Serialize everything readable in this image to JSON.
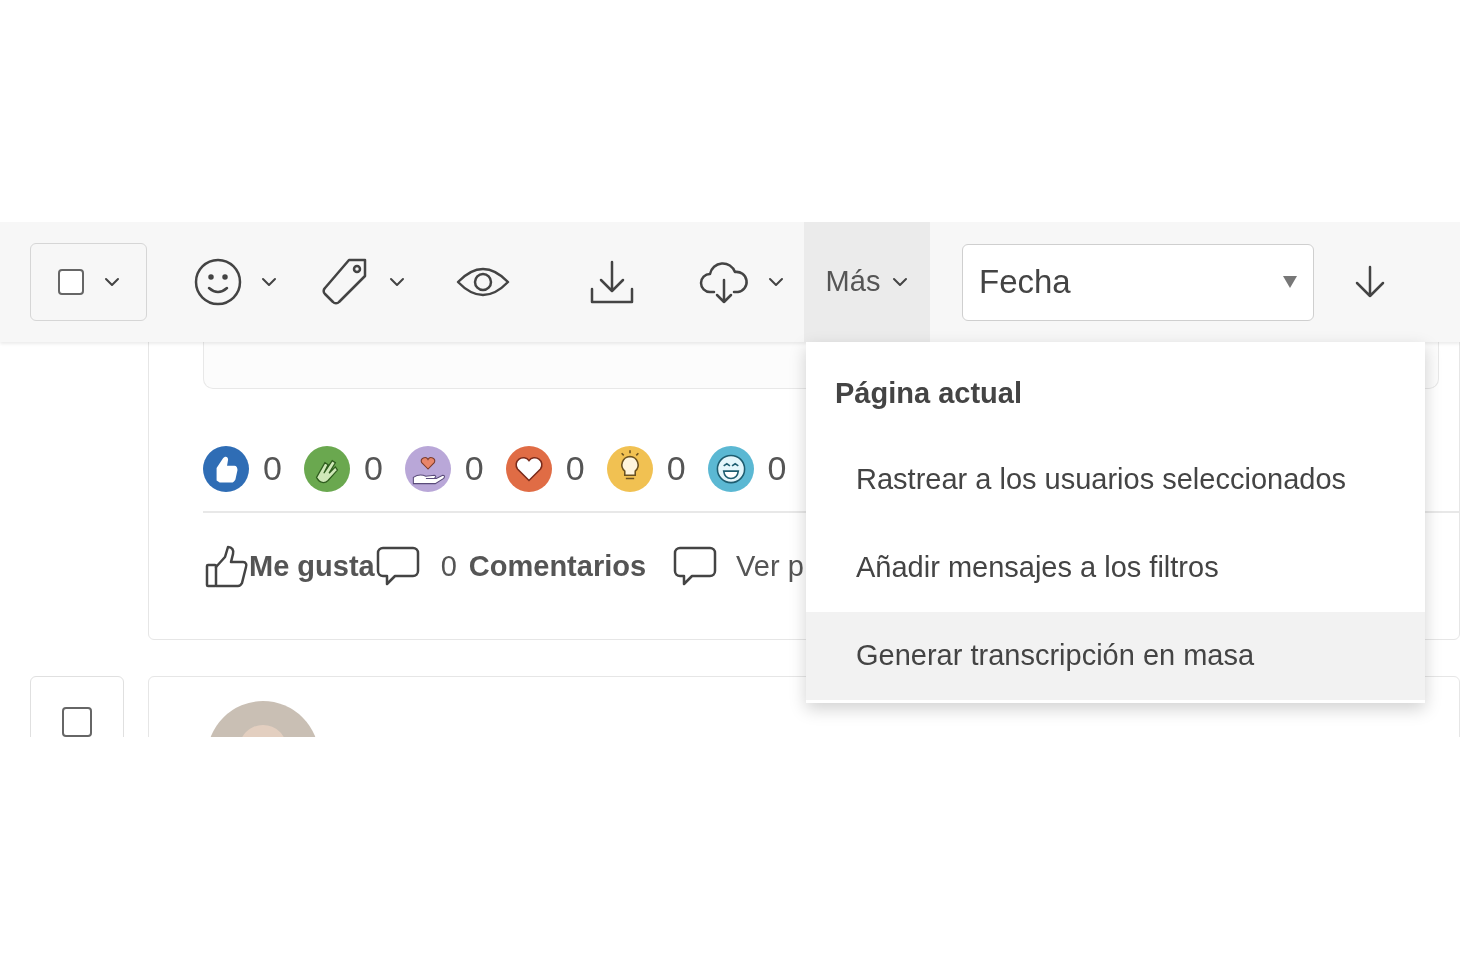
{
  "toolbar": {
    "select_checked": false,
    "more_label": "Más",
    "more_open": true,
    "sort_field": "Fecha"
  },
  "menu": {
    "heading": "Página actual",
    "items": [
      {
        "label": "Rastrear a los usuarios seleccionados",
        "selected": false
      },
      {
        "label": "Añadir mensajes a los filtros",
        "selected": false
      },
      {
        "label": "Generar transcripción en masa",
        "selected": true
      }
    ]
  },
  "post": {
    "reactions": [
      {
        "kind": "like",
        "color": "#2f6db5",
        "count": "0"
      },
      {
        "kind": "clap",
        "color": "#6aa84f",
        "count": "0"
      },
      {
        "kind": "support",
        "color": "#b9a7d8",
        "count": "0"
      },
      {
        "kind": "love",
        "color": "#e06c45",
        "count": "0"
      },
      {
        "kind": "idea",
        "color": "#f1c152",
        "count": "0"
      },
      {
        "kind": "laugh",
        "color": "#5bb8d3",
        "count": "0"
      }
    ],
    "actions": [
      {
        "kind": "like",
        "label": "Me gusta"
      },
      {
        "kind": "comment",
        "count": "0",
        "label": "Comentarios"
      },
      {
        "kind": "view",
        "label": "Ver p"
      }
    ]
  },
  "next_post": {
    "checked": false
  }
}
